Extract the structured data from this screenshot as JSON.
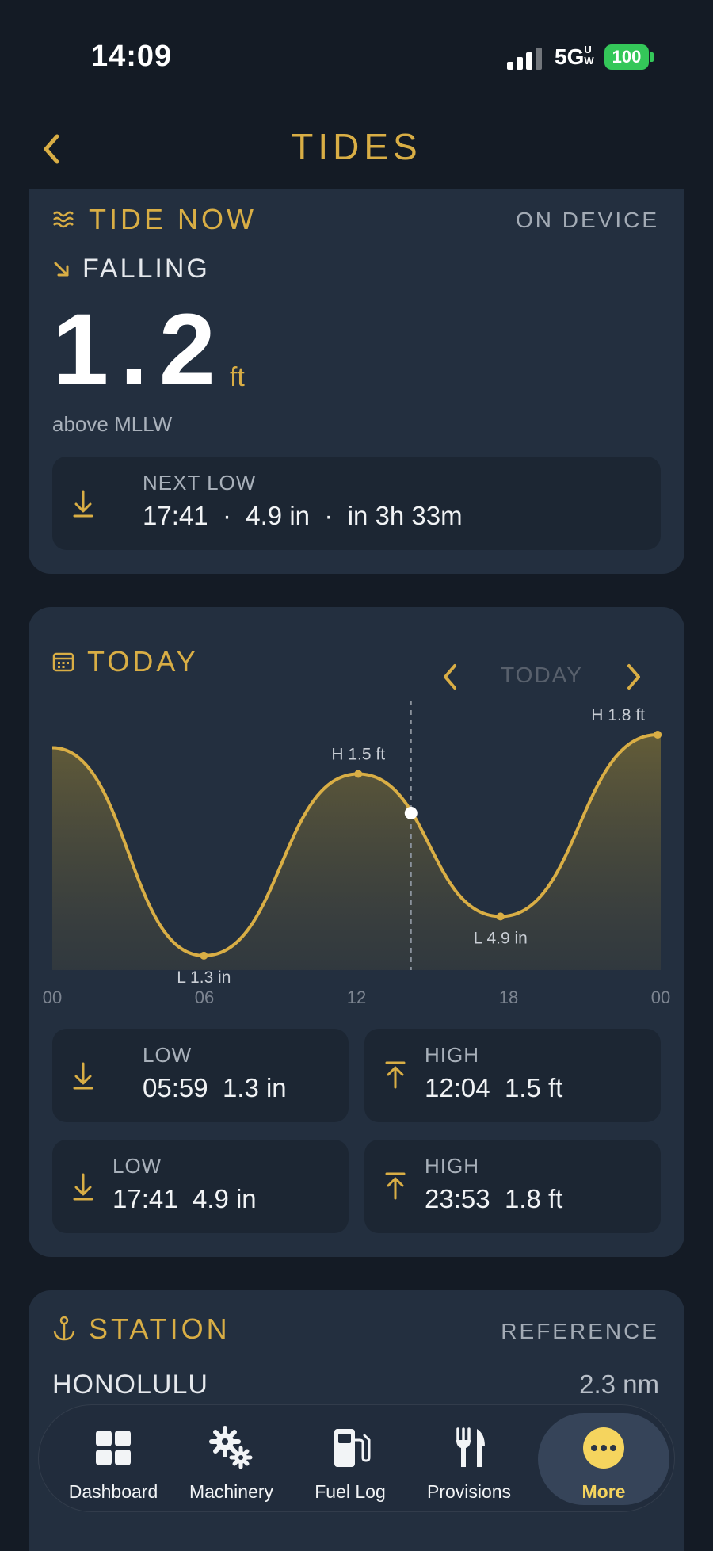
{
  "status_bar": {
    "time": "14:09",
    "network": "5G",
    "network_superscript": "UW",
    "battery": "100"
  },
  "header": {
    "title": "TIDES"
  },
  "tide_now": {
    "title": "TIDE NOW",
    "source": "ON DEVICE",
    "trend": "FALLING",
    "value": "1.2",
    "unit": "ft",
    "reference": "above MLLW",
    "next": {
      "label": "NEXT LOW",
      "time": "17:41",
      "height": "4.9 in",
      "countdown": "in 3h 33m",
      "separator": "·"
    }
  },
  "today": {
    "title": "TODAY",
    "nav_label": "TODAY",
    "events": [
      {
        "type": "LOW",
        "time": "05:59",
        "height": "1.3 in"
      },
      {
        "type": "HIGH",
        "time": "12:04",
        "height": "1.5 ft"
      },
      {
        "type": "LOW",
        "time": "17:41",
        "height": "4.9 in"
      },
      {
        "type": "HIGH",
        "time": "23:53",
        "height": "1.8 ft"
      }
    ]
  },
  "chart_data": {
    "type": "area",
    "x_tick_labels": [
      "00",
      "06",
      "12",
      "18",
      "00"
    ],
    "xlim": [
      0,
      24
    ],
    "x_units": "hours",
    "series": [
      {
        "x": [
          0,
          5.98,
          12.07,
          17.68,
          23.88,
          24
        ],
        "y": [
          1.7,
          0.11,
          1.5,
          0.41,
          1.8,
          1.8
        ]
      }
    ],
    "annotations": [
      {
        "x": 5.98,
        "y": 0.11,
        "text": "L 1.3 in"
      },
      {
        "x": 12.07,
        "y": 1.5,
        "text": "H 1.5 ft"
      },
      {
        "x": 17.68,
        "y": 0.41,
        "text": "L 4.9 in"
      },
      {
        "x": 23.88,
        "y": 1.8,
        "text": "H 1.8 ft"
      }
    ],
    "current": {
      "x": 14.15,
      "y": 1.2
    },
    "ylim": [
      0,
      2.0
    ],
    "grid": false,
    "colors": {
      "line": "#d9ae45",
      "fill": "#6a6137",
      "marker": "#ffffff"
    }
  },
  "station": {
    "title": "STATION",
    "label_right": "REFERENCE",
    "name": "HONOLULU",
    "distance": "2.3 nm"
  },
  "bottom_nav": {
    "items": [
      {
        "label": "Dashboard",
        "icon": "grid-icon"
      },
      {
        "label": "Machinery",
        "icon": "gears-icon"
      },
      {
        "label": "Fuel Log",
        "icon": "fuel-pump-icon"
      },
      {
        "label": "Provisions",
        "icon": "fork-knife-icon"
      },
      {
        "label": "More",
        "icon": "more-icon",
        "active": true
      }
    ]
  }
}
